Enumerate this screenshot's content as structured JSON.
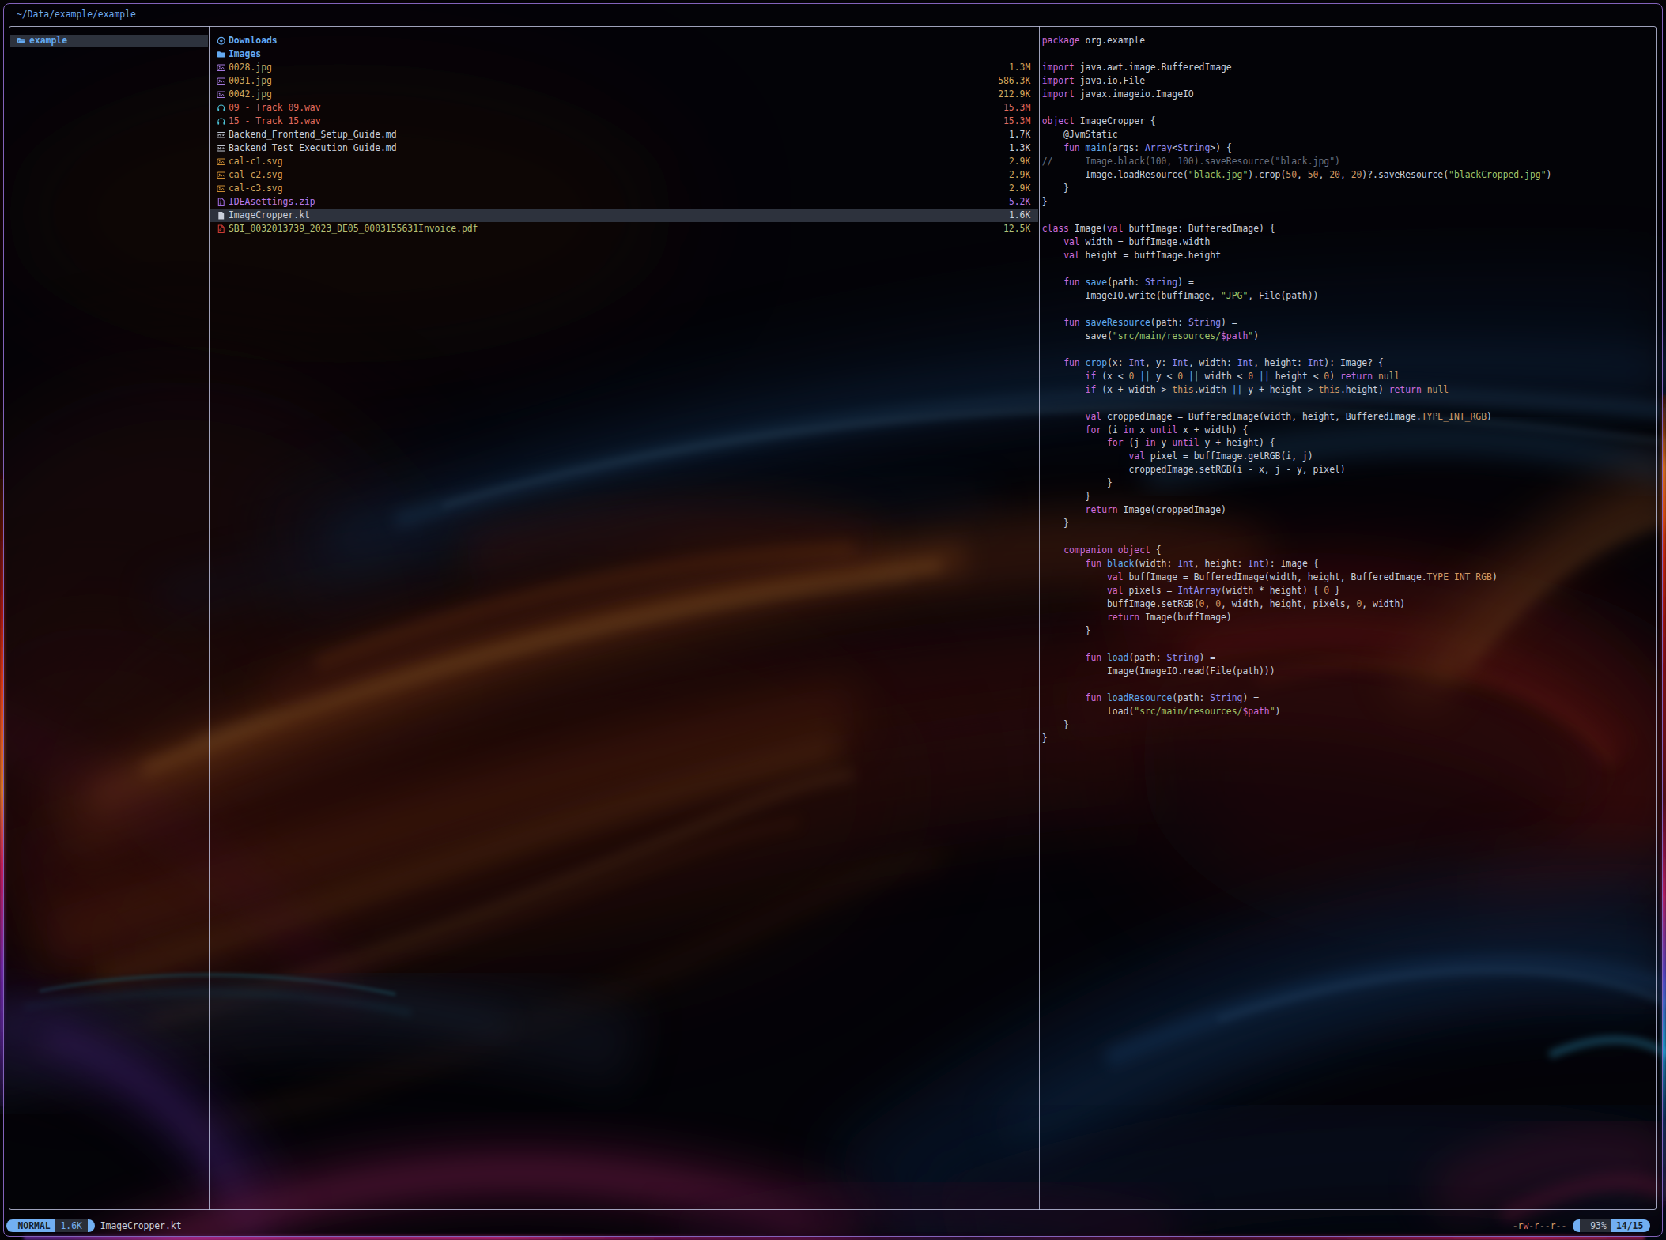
{
  "breadcrumb": {
    "path": "~/Data/example/example"
  },
  "parent_pane": {
    "items": [
      {
        "icon": "folder-open",
        "label": "example",
        "selected": true
      }
    ]
  },
  "file_pane": {
    "items": [
      {
        "icon": "folder-download",
        "name": "Downloads",
        "size": "",
        "color": "dir",
        "is_dir": true,
        "selected": false
      },
      {
        "icon": "folder-image",
        "name": "Images",
        "size": "",
        "color": "dir",
        "is_dir": true,
        "selected": false
      },
      {
        "icon": "image-file",
        "name": "0028.jpg",
        "size": "1.3M",
        "color": "gold",
        "is_dir": false,
        "selected": false
      },
      {
        "icon": "image-file",
        "name": "0031.jpg",
        "size": "586.3K",
        "color": "gold",
        "is_dir": false,
        "selected": false
      },
      {
        "icon": "image-file",
        "name": "0042.jpg",
        "size": "212.9K",
        "color": "gold",
        "is_dir": false,
        "selected": false
      },
      {
        "icon": "audio-file",
        "name": "09 - Track 09.wav",
        "size": "15.3M",
        "color": "salmon",
        "is_dir": false,
        "selected": false
      },
      {
        "icon": "audio-file",
        "name": "15 - Track 15.wav",
        "size": "15.3M",
        "color": "salmon",
        "is_dir": false,
        "selected": false
      },
      {
        "icon": "markdown-file",
        "name": "Backend_Frontend_Setup_Guide.md",
        "size": "1.7K",
        "color": "fg",
        "is_dir": false,
        "selected": false
      },
      {
        "icon": "markdown-file",
        "name": "Backend_Test_Execution_Guide.md",
        "size": "1.3K",
        "color": "fg",
        "is_dir": false,
        "selected": false
      },
      {
        "icon": "svg-file",
        "name": "cal-c1.svg",
        "size": "2.9K",
        "color": "gold",
        "is_dir": false,
        "selected": false
      },
      {
        "icon": "svg-file",
        "name": "cal-c2.svg",
        "size": "2.9K",
        "color": "gold",
        "is_dir": false,
        "selected": false
      },
      {
        "icon": "svg-file",
        "name": "cal-c3.svg",
        "size": "2.9K",
        "color": "gold",
        "is_dir": false,
        "selected": false
      },
      {
        "icon": "zip-file",
        "name": "IDEAsettings.zip",
        "size": "5.2K",
        "color": "violet",
        "is_dir": false,
        "selected": false
      },
      {
        "icon": "kt-file",
        "name": "ImageCropper.kt",
        "size": "1.6K",
        "color": "fg",
        "is_dir": false,
        "selected": true
      },
      {
        "icon": "pdf-file",
        "name": "SBI_0032013739_2023_DE05_0003155631Invoice.pdf",
        "size": "12.5K",
        "color": "lime",
        "is_dir": false,
        "selected": false
      }
    ]
  },
  "preview_pane": {
    "lines": [
      [
        [
          "k",
          "package"
        ],
        [
          "w",
          " org.example"
        ]
      ],
      [],
      [
        [
          "k",
          "import"
        ],
        [
          "w",
          " java.awt.image.BufferedImage"
        ]
      ],
      [
        [
          "k",
          "import"
        ],
        [
          "w",
          " java.io.File"
        ]
      ],
      [
        [
          "k",
          "import"
        ],
        [
          "w",
          " javax.imageio.ImageIO"
        ]
      ],
      [],
      [
        [
          "k",
          "object"
        ],
        [
          "w",
          " ImageCropper {"
        ]
      ],
      [
        [
          "w",
          "    @JvmStatic"
        ]
      ],
      [
        [
          "w",
          "    "
        ],
        [
          "k",
          "fun"
        ],
        [
          "w",
          " "
        ],
        [
          "f",
          "main"
        ],
        [
          "w",
          "(args: "
        ],
        [
          "t",
          "Array"
        ],
        [
          "w",
          "<"
        ],
        [
          "t",
          "String"
        ],
        [
          "w",
          ">) {"
        ]
      ],
      [
        [
          "c",
          "//      Image.black(100, 100).saveResource(\"black.jpg\")"
        ]
      ],
      [
        [
          "w",
          "        Image.loadResource("
        ],
        [
          "s",
          "\"black.jpg\""
        ],
        [
          "w",
          ").crop("
        ],
        [
          "n",
          "50"
        ],
        [
          "w",
          ", "
        ],
        [
          "n",
          "50"
        ],
        [
          "w",
          ", "
        ],
        [
          "n",
          "20"
        ],
        [
          "w",
          ", "
        ],
        [
          "n",
          "20"
        ],
        [
          "w",
          ")?.saveResource("
        ],
        [
          "s",
          "\"blackCropped.jpg\""
        ],
        [
          "w",
          ")"
        ]
      ],
      [
        [
          "w",
          "    }"
        ]
      ],
      [
        [
          "w",
          "}"
        ]
      ],
      [],
      [
        [
          "k",
          "class"
        ],
        [
          "w",
          " Image("
        ],
        [
          "k",
          "val"
        ],
        [
          "w",
          " buffImage: BufferedImage) {"
        ]
      ],
      [
        [
          "w",
          "    "
        ],
        [
          "k",
          "val"
        ],
        [
          "w",
          " width = buffImage.width"
        ]
      ],
      [
        [
          "w",
          "    "
        ],
        [
          "k",
          "val"
        ],
        [
          "w",
          " height = buffImage.height"
        ]
      ],
      [],
      [
        [
          "w",
          "    "
        ],
        [
          "k",
          "fun"
        ],
        [
          "w",
          " "
        ],
        [
          "f",
          "save"
        ],
        [
          "w",
          "(path: "
        ],
        [
          "t",
          "String"
        ],
        [
          "w",
          ") ="
        ]
      ],
      [
        [
          "w",
          "        ImageIO.write(buffImage, "
        ],
        [
          "s",
          "\"JPG\""
        ],
        [
          "w",
          ", File(path))"
        ]
      ],
      [],
      [
        [
          "w",
          "    "
        ],
        [
          "k",
          "fun"
        ],
        [
          "w",
          " "
        ],
        [
          "f",
          "saveResource"
        ],
        [
          "w",
          "(path: "
        ],
        [
          "t",
          "String"
        ],
        [
          "w",
          ") ="
        ]
      ],
      [
        [
          "w",
          "        save("
        ],
        [
          "s",
          "\"src/main/resources/"
        ],
        [
          "i",
          "$path"
        ],
        [
          "s",
          "\""
        ],
        [
          "w",
          ")"
        ]
      ],
      [],
      [
        [
          "w",
          "    "
        ],
        [
          "k",
          "fun"
        ],
        [
          "w",
          " "
        ],
        [
          "f",
          "crop"
        ],
        [
          "w",
          "(x: "
        ],
        [
          "t",
          "Int"
        ],
        [
          "w",
          ", y: "
        ],
        [
          "t",
          "Int"
        ],
        [
          "w",
          ", width: "
        ],
        [
          "t",
          "Int"
        ],
        [
          "w",
          ", height: "
        ],
        [
          "t",
          "Int"
        ],
        [
          "w",
          "): Image? {"
        ]
      ],
      [
        [
          "w",
          "        "
        ],
        [
          "k",
          "if"
        ],
        [
          "w",
          " (x < "
        ],
        [
          "n",
          "0"
        ],
        [
          "w",
          " "
        ],
        [
          "o",
          "||"
        ],
        [
          "w",
          " y < "
        ],
        [
          "n",
          "0"
        ],
        [
          "w",
          " "
        ],
        [
          "o",
          "||"
        ],
        [
          "w",
          " width < "
        ],
        [
          "n",
          "0"
        ],
        [
          "w",
          " "
        ],
        [
          "o",
          "||"
        ],
        [
          "w",
          " height < "
        ],
        [
          "n",
          "0"
        ],
        [
          "w",
          ") "
        ],
        [
          "k",
          "return"
        ],
        [
          "w",
          " "
        ],
        [
          "n",
          "null"
        ]
      ],
      [
        [
          "w",
          "        "
        ],
        [
          "k",
          "if"
        ],
        [
          "w",
          " (x + width > "
        ],
        [
          "n",
          "this"
        ],
        [
          "w",
          ".width "
        ],
        [
          "o",
          "||"
        ],
        [
          "w",
          " y + height > "
        ],
        [
          "n",
          "this"
        ],
        [
          "w",
          ".height) "
        ],
        [
          "k",
          "return"
        ],
        [
          "w",
          " "
        ],
        [
          "n",
          "null"
        ]
      ],
      [],
      [
        [
          "w",
          "        "
        ],
        [
          "k",
          "val"
        ],
        [
          "w",
          " croppedImage = BufferedImage(width, height, BufferedImage."
        ],
        [
          "n",
          "TYPE_INT_RGB"
        ],
        [
          "w",
          ")"
        ]
      ],
      [
        [
          "w",
          "        "
        ],
        [
          "k",
          "for"
        ],
        [
          "w",
          " (i "
        ],
        [
          "k",
          "in"
        ],
        [
          "w",
          " x "
        ],
        [
          "k",
          "until"
        ],
        [
          "w",
          " x + width) {"
        ]
      ],
      [
        [
          "w",
          "            "
        ],
        [
          "k",
          "for"
        ],
        [
          "w",
          " (j "
        ],
        [
          "k",
          "in"
        ],
        [
          "w",
          " y "
        ],
        [
          "k",
          "until"
        ],
        [
          "w",
          " y + height) {"
        ]
      ],
      [
        [
          "w",
          "                "
        ],
        [
          "k",
          "val"
        ],
        [
          "w",
          " pixel = buffImage.getRGB(i, j)"
        ]
      ],
      [
        [
          "w",
          "                croppedImage.setRGB(i - x, j - y, pixel)"
        ]
      ],
      [
        [
          "w",
          "            }"
        ]
      ],
      [
        [
          "w",
          "        }"
        ]
      ],
      [
        [
          "w",
          "        "
        ],
        [
          "k",
          "return"
        ],
        [
          "w",
          " Image(croppedImage)"
        ]
      ],
      [
        [
          "w",
          "    }"
        ]
      ],
      [],
      [
        [
          "w",
          "    "
        ],
        [
          "k",
          "companion"
        ],
        [
          "w",
          " "
        ],
        [
          "k",
          "object"
        ],
        [
          "w",
          " {"
        ]
      ],
      [
        [
          "w",
          "        "
        ],
        [
          "k",
          "fun"
        ],
        [
          "w",
          " "
        ],
        [
          "f",
          "black"
        ],
        [
          "w",
          "(width: "
        ],
        [
          "t",
          "Int"
        ],
        [
          "w",
          ", height: "
        ],
        [
          "t",
          "Int"
        ],
        [
          "w",
          "): Image {"
        ]
      ],
      [
        [
          "w",
          "            "
        ],
        [
          "k",
          "val"
        ],
        [
          "w",
          " buffImage = BufferedImage(width, height, BufferedImage."
        ],
        [
          "n",
          "TYPE_INT_RGB"
        ],
        [
          "w",
          ")"
        ]
      ],
      [
        [
          "w",
          "            "
        ],
        [
          "k",
          "val"
        ],
        [
          "w",
          " pixels = "
        ],
        [
          "t",
          "IntArray"
        ],
        [
          "w",
          "(width * height) { "
        ],
        [
          "n",
          "0"
        ],
        [
          "w",
          " }"
        ]
      ],
      [
        [
          "w",
          "            buffImage.setRGB("
        ],
        [
          "n",
          "0"
        ],
        [
          "w",
          ", "
        ],
        [
          "n",
          "0"
        ],
        [
          "w",
          ", width, height, pixels, "
        ],
        [
          "n",
          "0"
        ],
        [
          "w",
          ", width)"
        ]
      ],
      [
        [
          "w",
          "            "
        ],
        [
          "k",
          "return"
        ],
        [
          "w",
          " Image(buffImage)"
        ]
      ],
      [
        [
          "w",
          "        }"
        ]
      ],
      [],
      [
        [
          "w",
          "        "
        ],
        [
          "k",
          "fun"
        ],
        [
          "w",
          " "
        ],
        [
          "f",
          "load"
        ],
        [
          "w",
          "(path: "
        ],
        [
          "t",
          "String"
        ],
        [
          "w",
          ") ="
        ]
      ],
      [
        [
          "w",
          "            Image(ImageIO.read(File(path)))"
        ]
      ],
      [],
      [
        [
          "w",
          "        "
        ],
        [
          "k",
          "fun"
        ],
        [
          "w",
          " "
        ],
        [
          "f",
          "loadResource"
        ],
        [
          "w",
          "(path: "
        ],
        [
          "t",
          "String"
        ],
        [
          "w",
          ") ="
        ]
      ],
      [
        [
          "w",
          "            load("
        ],
        [
          "s",
          "\"src/main/resources/"
        ],
        [
          "i",
          "$path"
        ],
        [
          "s",
          "\""
        ],
        [
          "w",
          ")"
        ]
      ],
      [
        [
          "w",
          "    }"
        ]
      ],
      [
        [
          "w",
          "}"
        ]
      ]
    ]
  },
  "status_bar": {
    "mode": "NORMAL",
    "file_size": "1.6K",
    "file_name": "ImageCropper.kt",
    "permissions": "-rw-r--r--",
    "percent": "93%",
    "position": "14/15"
  },
  "colors": {
    "fg": "#c9cfdb",
    "dir": "#64a9f0",
    "gold": "#d2a55c",
    "salmon": "#e26a5c",
    "violet": "#b678e6",
    "lime": "#b7c175",
    "blue": "#6ea9ee",
    "keyword": "#cb6bd9",
    "function": "#61a9ef",
    "type": "#928ef2",
    "string": "#9fc36a",
    "number": "#d19a66",
    "comment": "#6b7280",
    "operator": "#61a9ef",
    "interpolation": "#cb6bd9",
    "highlight_bg": "#2d323d",
    "frame_border": "rgba(193,197,226,0.82)",
    "window_border": "#8262ba",
    "window_dim": "rgba(4,3,8,0.58)",
    "pill_blue": "#72aff2",
    "pill_dark": "#2a2e38",
    "pill_text_dark": "#141f2e",
    "perm_dash": "#6e5a4e",
    "perm_r": "#d19a66",
    "perm_w": "#d8685e",
    "icon_image": "#a379dd",
    "icon_audio": "#4cc0d4",
    "icon_svg": "#cc8c33",
    "icon_zip": "#a06be0",
    "icon_pdf": "#cc3b33",
    "icon_md": "#c9cfdb",
    "icon_file": "#c9cfdb"
  }
}
